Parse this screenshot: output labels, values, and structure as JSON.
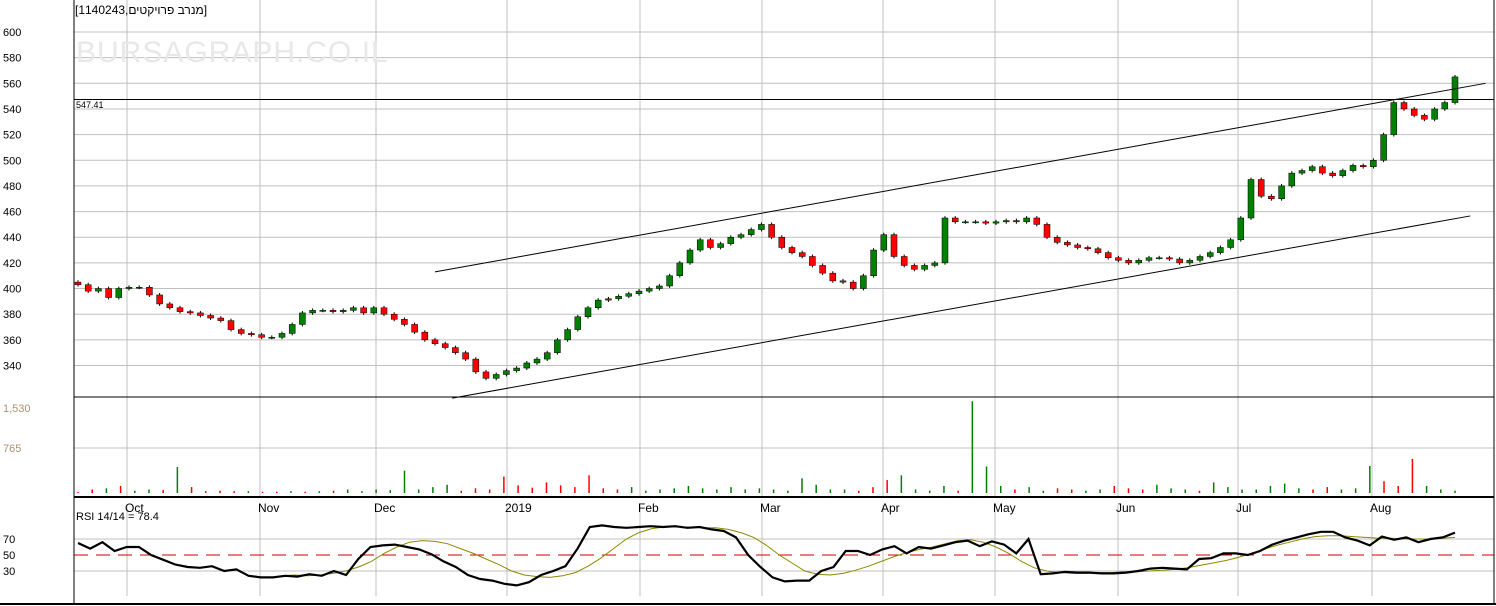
{
  "title": "[1140243,מנרב פרויקטים]",
  "watermark": "BURSAGRAPH.CO.IL",
  "level_label": "547.41",
  "rsi_label": "RSI 14/14 = 78.4",
  "colors": {
    "up": "#008000",
    "down": "#ff0000",
    "rsi": "#000000",
    "rsi_ma": "#8b8b00",
    "mid": "#cc0000",
    "grid": "#c0c0c0"
  },
  "chart_data": [
    {
      "type": "candlestick",
      "title": "[1140243,מנרב פרויקטים]",
      "ylim": [
        314,
        610
      ],
      "yticks": [
        340,
        360,
        380,
        400,
        420,
        440,
        460,
        480,
        500,
        520,
        540,
        560,
        580,
        600
      ],
      "months": [
        "Oct",
        "Nov",
        "Dec",
        "2019",
        "Feb",
        "Mar",
        "Apr",
        "May",
        "Jun",
        "Jul",
        "Aug"
      ],
      "closes": [
        403,
        398,
        400,
        393,
        400,
        401,
        401,
        395,
        388,
        385,
        382,
        381,
        379,
        377,
        375,
        368,
        365,
        364,
        362,
        362,
        365,
        372,
        381,
        383,
        383,
        382,
        383,
        385,
        381,
        385,
        380,
        376,
        372,
        366,
        360,
        357,
        354,
        350,
        345,
        335,
        330,
        333,
        336,
        338,
        342,
        345,
        350,
        360,
        368,
        378,
        385,
        391,
        392,
        394,
        396,
        398,
        400,
        402,
        410,
        420,
        430,
        438,
        432,
        435,
        440,
        442,
        446,
        450,
        440,
        432,
        428,
        425,
        418,
        412,
        406,
        405,
        400,
        410,
        430,
        442,
        425,
        418,
        415,
        418,
        420,
        455,
        452,
        452,
        452,
        451,
        452,
        453,
        452,
        455,
        450,
        440,
        436,
        434,
        432,
        431,
        428,
        424,
        422,
        420,
        422,
        424,
        424,
        423,
        420,
        422,
        425,
        428,
        432,
        438,
        455,
        485,
        472,
        470,
        480,
        490,
        492,
        495,
        490,
        488,
        492,
        496,
        495,
        500,
        520,
        545,
        540,
        535,
        532,
        540,
        545,
        565
      ],
      "open_first": 405,
      "hline": 547.41,
      "trendlines": [
        {
          "name": "upper",
          "from": [
            35,
            413
          ],
          "to": [
            138,
            560
          ]
        },
        {
          "name": "lower",
          "from": [
            36.7,
            314.6
          ],
          "to": [
            136.5,
            456.6
          ]
        }
      ]
    },
    {
      "type": "bar",
      "title": "Volume",
      "yticks": [
        "765",
        "1,530"
      ],
      "ylim": [
        0,
        1560
      ],
      "values": [
        20,
        60,
        80,
        120,
        40,
        60,
        50,
        440,
        100,
        30,
        40,
        30,
        30,
        20,
        20,
        30,
        20,
        30,
        40,
        60,
        30,
        60,
        50,
        380,
        60,
        100,
        140,
        40,
        80,
        60,
        280,
        130,
        90,
        180,
        130,
        100,
        300,
        80,
        60,
        100,
        40,
        60,
        80,
        120,
        80,
        60,
        100,
        60,
        80,
        60,
        40,
        250,
        140,
        60,
        60,
        40,
        100,
        220,
        300,
        60,
        40,
        120,
        40,
        1560,
        450,
        120,
        60,
        100,
        40,
        80,
        60,
        40,
        60,
        120,
        80,
        60,
        140,
        80,
        60,
        40,
        180,
        100,
        60,
        60,
        120,
        160,
        80,
        60,
        100,
        60,
        80,
        460,
        200,
        120,
        580,
        120,
        60,
        40
      ],
      "up": [
        0,
        0,
        1,
        0,
        1,
        1,
        0,
        1,
        0,
        0,
        0,
        0,
        1,
        0,
        0,
        1,
        0,
        1,
        0,
        1,
        1,
        1,
        1,
        1,
        1,
        1,
        1,
        0,
        0,
        0,
        0,
        0,
        0,
        0,
        0,
        0,
        0,
        0,
        0,
        1,
        1,
        1,
        1,
        1,
        1,
        1,
        1,
        1,
        1,
        1,
        1,
        1,
        1,
        1,
        1,
        0,
        0,
        0,
        1,
        1,
        1,
        1,
        0,
        1,
        1,
        1,
        0,
        1,
        1,
        0,
        0,
        1,
        1,
        0,
        0,
        0,
        1,
        1,
        1,
        0,
        1,
        1,
        1,
        1,
        1,
        1,
        1,
        0,
        0,
        1,
        1,
        1,
        0,
        0,
        0,
        1,
        1,
        1
      ]
    },
    {
      "type": "line",
      "title": "RSI 14/14",
      "yticks": [
        30,
        50,
        70
      ],
      "ylim": [
        10,
        95
      ],
      "midline": 50,
      "rsi": [
        65,
        58,
        66,
        55,
        60,
        60,
        50,
        44,
        38,
        35,
        34,
        36,
        30,
        32,
        24,
        22,
        22,
        24,
        23,
        26,
        24,
        30,
        25,
        45,
        60,
        62,
        63,
        60,
        57,
        51,
        42,
        35,
        25,
        20,
        18,
        14,
        12,
        16,
        25,
        30,
        36,
        58,
        85,
        87,
        85,
        84,
        85,
        86,
        85,
        86,
        84,
        85,
        82,
        80,
        72,
        50,
        35,
        22,
        17,
        18,
        18,
        30,
        35,
        55,
        55,
        50,
        57,
        61,
        52,
        60,
        58,
        62,
        66,
        68,
        61,
        67,
        63,
        52,
        70,
        26,
        27,
        29,
        28,
        28,
        27,
        27,
        28,
        30,
        33,
        34,
        33,
        32,
        45,
        46,
        52,
        52,
        50,
        55,
        63,
        68,
        72,
        76,
        79,
        79,
        72,
        68,
        62,
        73,
        69,
        72,
        66,
        70,
        72,
        78
      ],
      "ma": [
        null,
        null,
        null,
        null,
        null,
        null,
        null,
        null,
        null,
        null,
        null,
        null,
        null,
        null,
        null,
        null,
        24,
        25,
        24,
        25,
        27,
        30,
        35,
        42,
        52,
        60,
        66,
        68,
        67,
        64,
        58,
        52,
        45,
        38,
        30,
        25,
        23,
        22,
        24,
        28,
        36,
        46,
        58,
        70,
        78,
        83,
        85,
        85,
        85,
        84,
        84,
        82,
        78,
        72,
        62,
        50,
        40,
        30,
        26,
        25,
        27,
        31,
        36,
        42,
        48,
        53,
        57,
        60,
        64,
        68,
        69,
        66,
        60,
        52,
        42,
        34,
        30,
        28,
        27,
        27,
        28,
        28,
        29,
        29,
        30,
        31,
        32,
        34,
        37,
        40,
        43,
        47,
        52,
        57,
        62,
        66,
        70,
        73,
        74,
        74,
        73,
        72,
        71,
        71,
        70,
        70,
        70,
        71,
        72
      ]
    }
  ]
}
